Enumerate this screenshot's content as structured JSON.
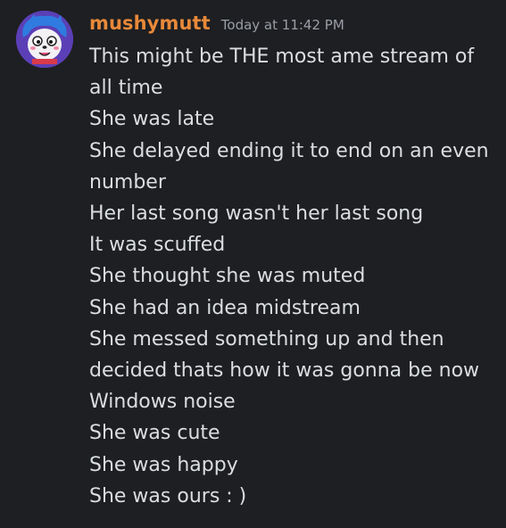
{
  "message": {
    "author": {
      "username": "mushymutt",
      "username_color": "#e8893a",
      "avatar_icon": "cartoon-dog-avatar-icon"
    },
    "timestamp": "Today at 11:42 PM",
    "lines": [
      "This might be THE most ame stream of",
      "all time",
      "She was late",
      "She delayed ending it to end on an even",
      "number",
      "Her last song wasn't her last song",
      "It was scuffed",
      "She thought she was muted",
      "She had an idea midstream",
      "She messed something up and then",
      "decided thats how it was gonna be now",
      "Windows noise",
      "She was cute",
      "She was happy",
      "She was ours : )"
    ]
  },
  "colors": {
    "background": "#1e1f22",
    "text": "#dbdee1",
    "timestamp": "#9a9ea6"
  }
}
